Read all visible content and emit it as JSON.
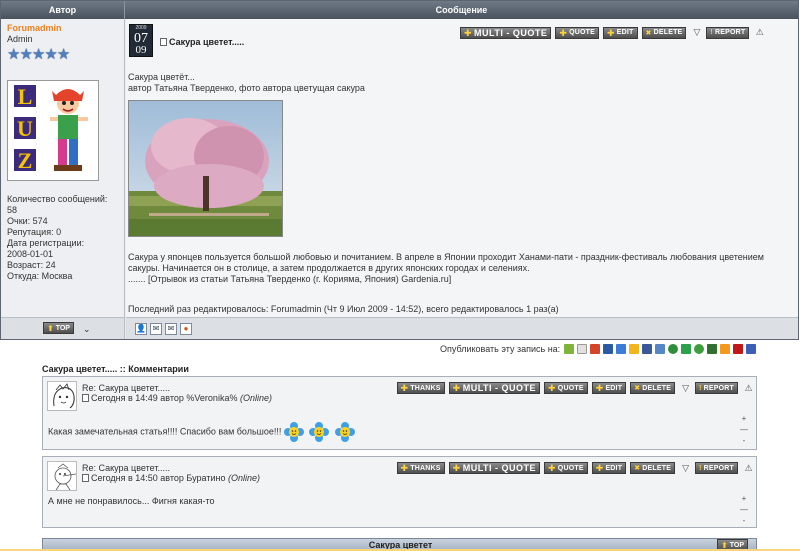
{
  "table": {
    "col_author": "Автор",
    "col_message": "Сообщение"
  },
  "author": {
    "name": "Forumadmin",
    "role": "Admin",
    "stars": 5,
    "stats": [
      "Количество сообщений:",
      "58",
      "Очки: 574",
      "Репутация: 0",
      "Дата регистрации:",
      "2008-01-01",
      "Возраст: 24",
      "Откуда: Москва"
    ],
    "avatar_letters": [
      "L",
      "U",
      "Z"
    ]
  },
  "post": {
    "date_year": "2009",
    "date_day": "07",
    "date_month": "09",
    "title": "Сакура цветет.....",
    "line1": "Сакура цветёт...",
    "line2": "автор Татьяна Тверденко, фото автора цветущая сакура",
    "paragraph": "Сакура у японцев пользуется большой любовью и почитанием. В апреле в Японии проходит Ханами-пати - праздник-фестиваль любования цветением сакуры. Начинается он в столице, а затем продолжается в других японских городах и селениях.",
    "excerpt": "....... [Отрывок из статьи Татьяна Тверденко (г. Корияма, Япония) Gardenia.ru]",
    "edited": "Последний раз редактировалось: Forumadmin (Чт 9 Июл 2009 - 14:52), всего редактировалось 1 раз(а)"
  },
  "buttons": {
    "thanks": "THANKS",
    "multi_quote": "MULTI - QUOTE",
    "quote": "QUOTE",
    "edit": "EDIT",
    "delete": "DELETE",
    "report": "REPORT",
    "top": "TOP"
  },
  "share": {
    "label": "Опубликовать эту запись на:"
  },
  "comments": {
    "header": "Сакура цветет..... :: Комментарии",
    "items": [
      {
        "title": "Re: Сакура цветет.....",
        "meta_prefix": "Сегодня в 14:49 автор %Veronika%",
        "status": "(Online)",
        "text": "Какая замечательная статья!!!! Спасибо вам большое!!!"
      },
      {
        "title": "Re: Сакура цветет.....",
        "meta_prefix": "Сегодня в 14:50 автор Буратино",
        "status": "(Online)",
        "text": "А мне не понравилось... Фигня какая-то"
      }
    ],
    "side_plus": "+",
    "side_minus": "-"
  },
  "bottom": {
    "title": "Сакура цветет"
  },
  "colors": {
    "header_bg": "#49525d",
    "author_name": "#f07f1b",
    "button_bg": "#5a5a5a",
    "button_accent": "#ffd23a"
  }
}
